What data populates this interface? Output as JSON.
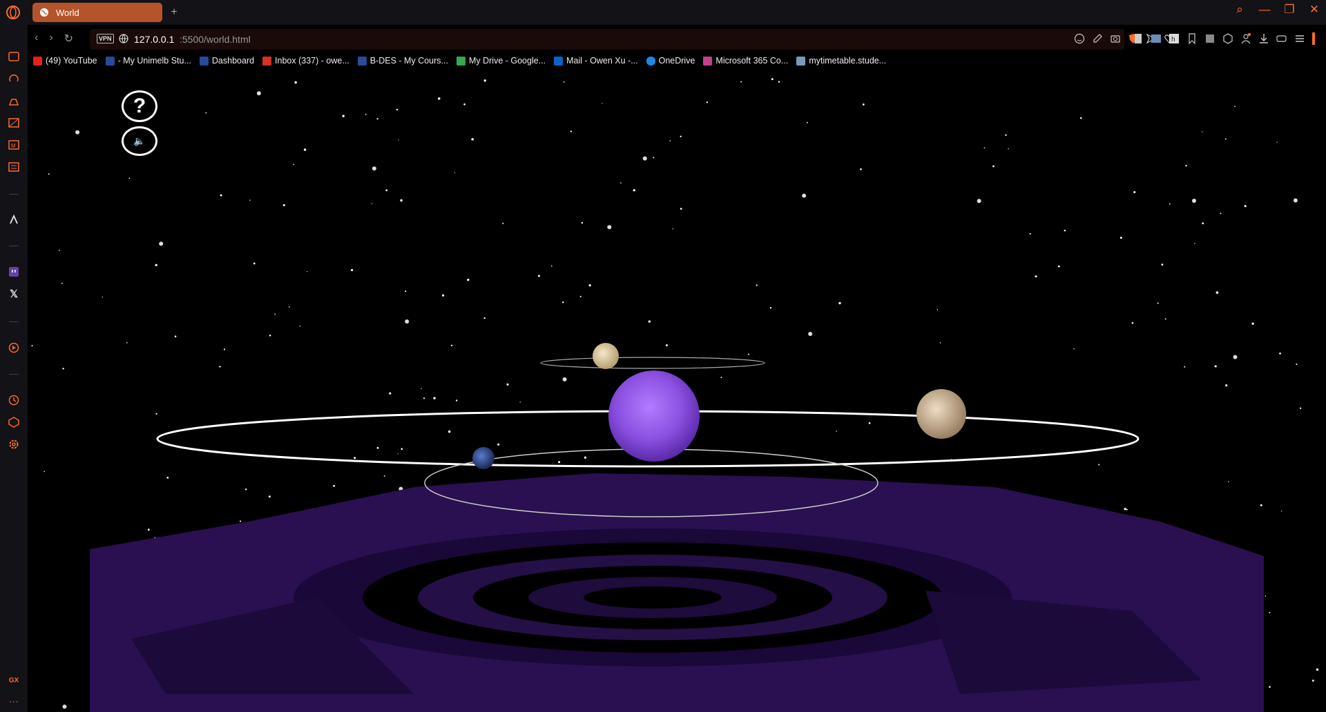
{
  "browser": {
    "tab": {
      "title": "World"
    },
    "address": {
      "vpn_label": "VPN",
      "host": "127.0.0.1",
      "path": ":5500/world.html"
    },
    "bookmarks": [
      {
        "label": "(49) YouTube",
        "icon": "youtube-icon",
        "color": "#e62117"
      },
      {
        "label": "- My Unimelb Stu...",
        "icon": "unimelb-icon",
        "color": "#2a4a9a"
      },
      {
        "label": "Dashboard",
        "icon": "canvas-icon",
        "color": "#2a4a9a"
      },
      {
        "label": "Inbox (337) - owe...",
        "icon": "gmail-icon",
        "color": "#d93025"
      },
      {
        "label": "B-DES - My Cours...",
        "icon": "unimelb-icon",
        "color": "#2a4a9a"
      },
      {
        "label": "My Drive - Google...",
        "icon": "drive-icon",
        "color": "#34a853"
      },
      {
        "label": "Mail - Owen Xu -...",
        "icon": "outlook-icon",
        "color": "#0a64c8"
      },
      {
        "label": "OneDrive",
        "icon": "onedrive-icon",
        "color": "#1e88e5"
      },
      {
        "label": "Microsoft 365 Co...",
        "icon": "m365-icon",
        "color": "#c2418f"
      },
      {
        "label": "mytimetable.stude...",
        "icon": "timetable-icon",
        "color": "#7a9ab8"
      }
    ]
  },
  "scene": {
    "help_label": "?",
    "sound_label": "🔈",
    "accent": "#ff6a2e",
    "sun_color": "#8a4fe0",
    "platform_color": "#2a1050"
  }
}
